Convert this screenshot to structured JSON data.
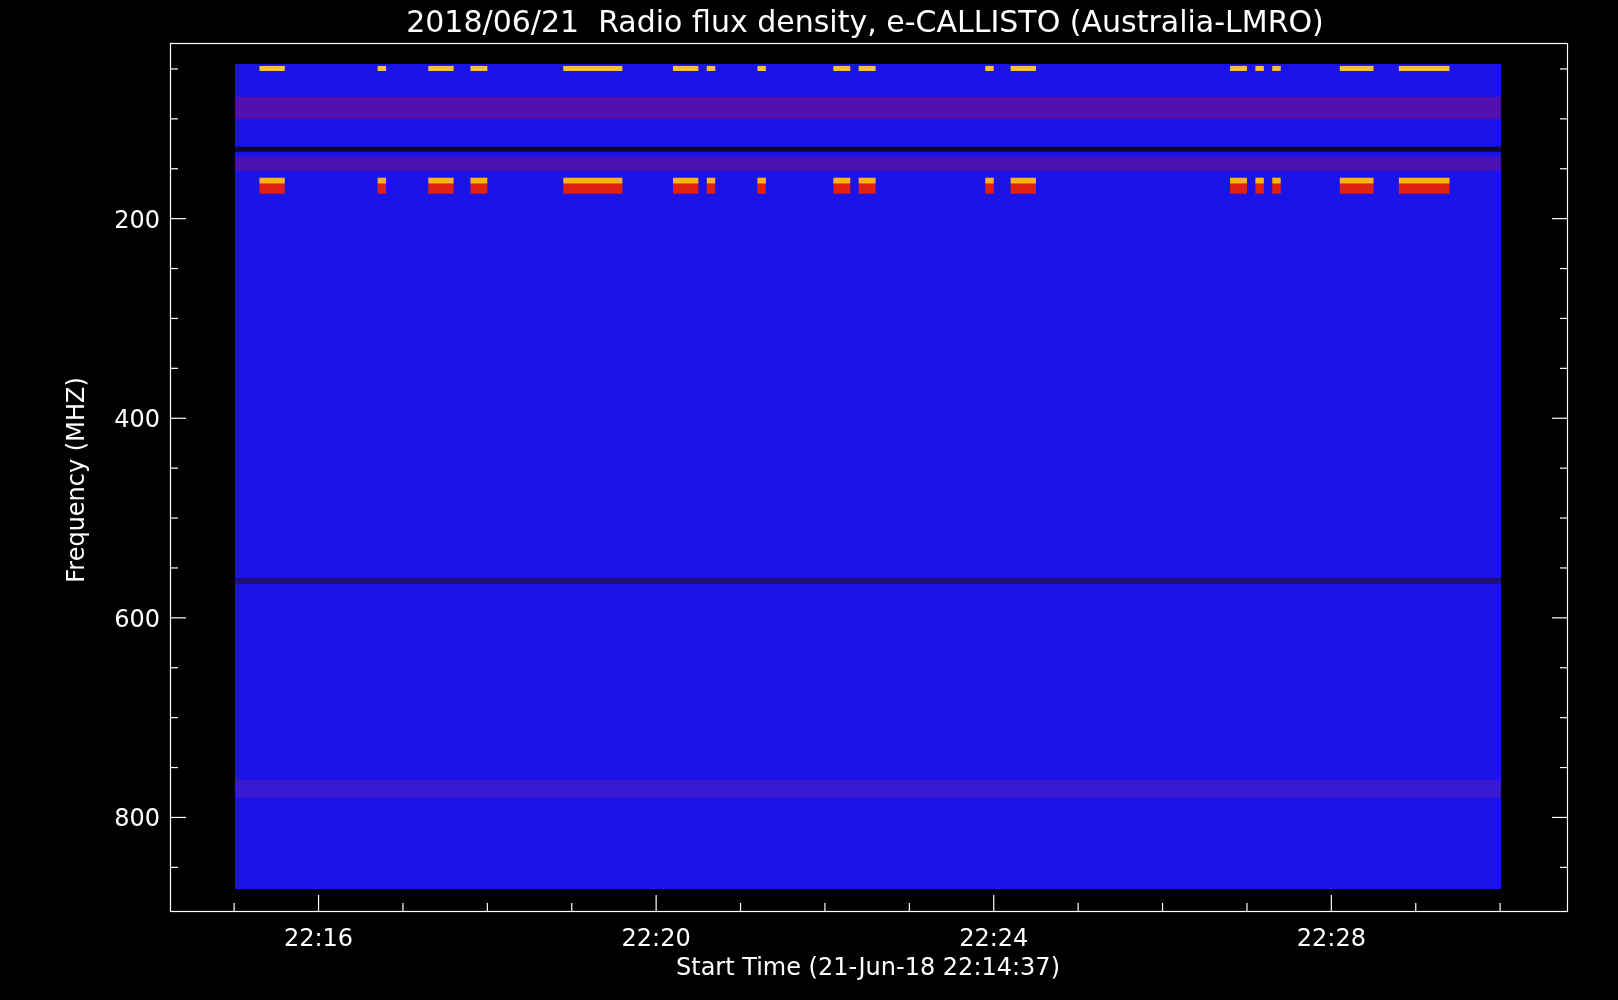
{
  "title": "2018/06/21  Radio flux density, e-CALLISTO (Australia-LMRO)",
  "y_axis": {
    "label": "Frequency (MHZ)",
    "ticks": [
      "200",
      "400",
      "600",
      "800"
    ]
  },
  "x_axis": {
    "label": "Start Time (21-Jun-18 22:14:37)",
    "ticks": [
      "22:16",
      "22:20",
      "22:24",
      "22:28"
    ]
  }
}
